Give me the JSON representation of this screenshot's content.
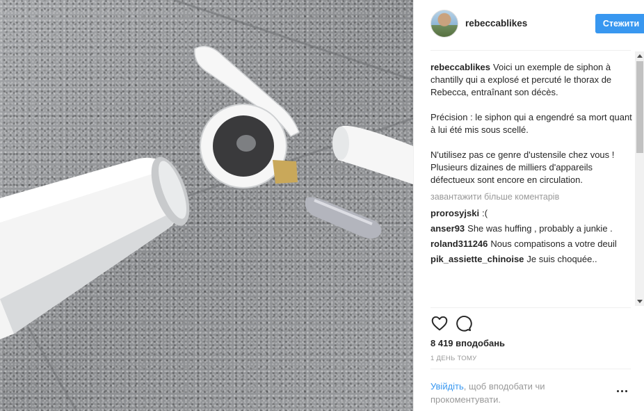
{
  "post": {
    "username": "rebeccablikes",
    "follow_label": "Стежити",
    "caption": {
      "username": "rebeccablikes",
      "paragraphs": [
        "Voici un exemple de siphon à chantilly qui a explosé et percuté le thorax de Rebecca, entraînant son décès.",
        "Précision : le siphon qui a engendré sa mort quant à lui été mis sous scellé.",
        "N'utilisez pas ce genre d'ustensile chez vous ! Plusieurs dizaines de milliers d'appareils défectueux sont encore en circulation."
      ]
    },
    "load_more_label": "завантажити більше коментарів",
    "comments": [
      {
        "username": "prorosyjski",
        "text": ":("
      },
      {
        "username": "anser93",
        "text": "She was huffing , probably a junkie ."
      },
      {
        "username": "roland311246",
        "text": "Nous compatisons a votre deuil"
      },
      {
        "username": "pik_assiette_chinoise",
        "text": "Je suis choquée.."
      }
    ],
    "likes_label": "8 419 вподобань",
    "time_label": "1 день тому",
    "login_prompt": {
      "link": "Увійдіть",
      "rest": ", щоб вподобати чи прокоментувати."
    }
  },
  "icons": {
    "like": "heart-outline-icon",
    "comment": "speech-bubble-icon",
    "more": "ellipsis-icon"
  },
  "colors": {
    "accent": "#3897f0",
    "text": "#262626",
    "muted": "#999999",
    "divider": "#efefef"
  }
}
